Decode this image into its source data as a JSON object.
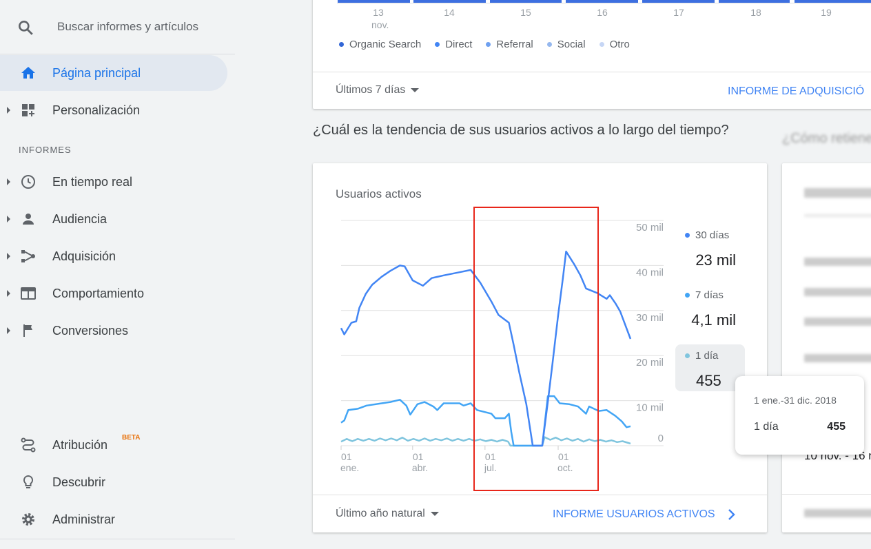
{
  "sidebar": {
    "search_placeholder": "Buscar informes y artículos",
    "items": [
      {
        "label": "Página principal",
        "icon": "home-icon",
        "active": true
      },
      {
        "label": "Personalización",
        "icon": "dashboard-plus-icon"
      }
    ],
    "section_header": "INFORMES",
    "reports": [
      {
        "label": "En tiempo real",
        "icon": "clock-icon"
      },
      {
        "label": "Audiencia",
        "icon": "person-icon"
      },
      {
        "label": "Adquisición",
        "icon": "acquisition-icon"
      },
      {
        "label": "Comportamiento",
        "icon": "behavior-icon"
      },
      {
        "label": "Conversiones",
        "icon": "flag-icon"
      }
    ],
    "bottom": [
      {
        "label": "Atribución",
        "badge": "BETA",
        "icon": "attribution-icon"
      },
      {
        "label": "Descubrir",
        "icon": "lightbulb-icon"
      },
      {
        "label": "Administrar",
        "icon": "gear-icon"
      }
    ]
  },
  "acquisition_card": {
    "x_ticks": [
      "13",
      "14",
      "15",
      "16",
      "17",
      "18",
      "19"
    ],
    "x_month": "nov.",
    "legend": [
      {
        "label": "Organic Search",
        "color": "#3367d6"
      },
      {
        "label": "Direct",
        "color": "#4285f4"
      },
      {
        "label": "Referral",
        "color": "#6fa0f0"
      },
      {
        "label": "Social",
        "color": "#96b8ee"
      },
      {
        "label": "Otro",
        "color": "#c6d6f5"
      }
    ],
    "range_label": "Últimos 7 días",
    "report_link": "INFORME DE ADQUISICIÓ"
  },
  "active_users_section": {
    "heading": "¿Cuál es la tendencia de sus usuarios activos a lo largo del tiempo?",
    "card_title": "Usuarios activos",
    "summary": [
      {
        "label": "30 días",
        "value": "23 mil",
        "color": "#4285f4"
      },
      {
        "label": "7 días",
        "value": "4,1 mil",
        "color": "#42a5f5"
      },
      {
        "label": "1 día",
        "value": "455",
        "color": "#80c5de",
        "highlighted": true
      }
    ],
    "range_label": "Último año natural",
    "report_link": "INFORME USUARIOS ACTIVOS",
    "tooltip": {
      "date": "1 ene.-31 dic. 2018",
      "label": "1 día",
      "value": "455"
    }
  },
  "chart_data": {
    "type": "line",
    "ylim": [
      0,
      50000
    ],
    "y_ticks": [
      {
        "v": 0,
        "label": "0"
      },
      {
        "v": 10000,
        "label": "10 mil"
      },
      {
        "v": 20000,
        "label": "20 mil"
      },
      {
        "v": 30000,
        "label": "30 mil"
      },
      {
        "v": 40000,
        "label": "40 mil"
      },
      {
        "v": 50000,
        "label": "50 mil"
      }
    ],
    "x_ticks": [
      {
        "date": "2018-01-01",
        "day": "01",
        "month": "ene."
      },
      {
        "date": "2018-04-01",
        "day": "01",
        "month": "abr."
      },
      {
        "date": "2018-07-01",
        "day": "01",
        "month": "jul."
      },
      {
        "date": "2018-10-01",
        "day": "01",
        "month": "oct."
      }
    ],
    "xlim": [
      "2018-01-01",
      "2018-12-31"
    ],
    "grid": true,
    "series": [
      {
        "name": "30 días",
        "color": "#4285f4",
        "points": [
          [
            "2018-01-01",
            26100
          ],
          [
            "2018-01-05",
            24700
          ],
          [
            "2018-01-14",
            27300
          ],
          [
            "2018-01-20",
            27600
          ],
          [
            "2018-01-24",
            30600
          ],
          [
            "2018-02-01",
            33700
          ],
          [
            "2018-02-09",
            35700
          ],
          [
            "2018-02-21",
            37500
          ],
          [
            "2018-03-04",
            38800
          ],
          [
            "2018-03-16",
            40000
          ],
          [
            "2018-03-22",
            39800
          ],
          [
            "2018-04-01",
            36700
          ],
          [
            "2018-04-14",
            35500
          ],
          [
            "2018-04-25",
            37200
          ],
          [
            "2018-05-10",
            37800
          ],
          [
            "2018-05-30",
            38500
          ],
          [
            "2018-06-13",
            39000
          ],
          [
            "2018-06-25",
            36200
          ],
          [
            "2018-07-09",
            32000
          ],
          [
            "2018-07-18",
            29000
          ],
          [
            "2018-07-31",
            27300
          ],
          [
            "2018-08-06",
            22400
          ],
          [
            "2018-08-13",
            16300
          ],
          [
            "2018-08-22",
            9200
          ],
          [
            "2018-08-30",
            0
          ],
          [
            "2018-09-11",
            0
          ],
          [
            "2018-09-18",
            9700
          ],
          [
            "2018-09-24",
            18400
          ],
          [
            "2018-10-01",
            29000
          ],
          [
            "2018-10-07",
            37200
          ],
          [
            "2018-10-11",
            43100
          ],
          [
            "2018-10-21",
            40300
          ],
          [
            "2018-10-29",
            37800
          ],
          [
            "2018-11-05",
            34900
          ],
          [
            "2018-11-19",
            33900
          ],
          [
            "2018-12-01",
            32600
          ],
          [
            "2018-12-05",
            33400
          ],
          [
            "2018-12-12",
            31600
          ],
          [
            "2018-12-18",
            29800
          ],
          [
            "2018-12-24",
            27000
          ],
          [
            "2018-12-31",
            23700
          ]
        ]
      },
      {
        "name": "7 días",
        "color": "#42a5f5",
        "points": [
          [
            "2018-01-01",
            5100
          ],
          [
            "2018-01-05",
            5600
          ],
          [
            "2018-01-10",
            7900
          ],
          [
            "2018-01-22",
            8200
          ],
          [
            "2018-02-02",
            8900
          ],
          [
            "2018-02-21",
            9400
          ],
          [
            "2018-03-04",
            9700
          ],
          [
            "2018-03-16",
            10200
          ],
          [
            "2018-03-24",
            8900
          ],
          [
            "2018-03-29",
            6900
          ],
          [
            "2018-04-07",
            9200
          ],
          [
            "2018-04-16",
            9700
          ],
          [
            "2018-04-27",
            8700
          ],
          [
            "2018-05-02",
            7900
          ],
          [
            "2018-05-10",
            9400
          ],
          [
            "2018-05-30",
            9400
          ],
          [
            "2018-06-04",
            8900
          ],
          [
            "2018-06-13",
            9400
          ],
          [
            "2018-06-21",
            7900
          ],
          [
            "2018-07-09",
            7100
          ],
          [
            "2018-07-14",
            6100
          ],
          [
            "2018-07-26",
            6100
          ],
          [
            "2018-07-31",
            7100
          ],
          [
            "2018-08-03",
            3100
          ],
          [
            "2018-08-06",
            0
          ],
          [
            "2018-09-11",
            0
          ],
          [
            "2018-09-18",
            11000
          ],
          [
            "2018-09-26",
            11000
          ],
          [
            "2018-10-03",
            9400
          ],
          [
            "2018-10-15",
            9200
          ],
          [
            "2018-10-26",
            8700
          ],
          [
            "2018-11-05",
            7100
          ],
          [
            "2018-11-09",
            8700
          ],
          [
            "2018-11-21",
            7700
          ],
          [
            "2018-12-01",
            7900
          ],
          [
            "2018-12-12",
            6600
          ],
          [
            "2018-12-20",
            5400
          ],
          [
            "2018-12-26",
            4100
          ],
          [
            "2018-12-31",
            4300
          ]
        ]
      },
      {
        "name": "1 día",
        "color": "#80c5de",
        "points": [
          [
            "2018-01-01",
            900
          ],
          [
            "2018-01-08",
            1500
          ],
          [
            "2018-01-15",
            1000
          ],
          [
            "2018-01-22",
            1500
          ],
          [
            "2018-01-29",
            1100
          ],
          [
            "2018-02-05",
            1500
          ],
          [
            "2018-02-12",
            1100
          ],
          [
            "2018-02-19",
            1600
          ],
          [
            "2018-02-26",
            1200
          ],
          [
            "2018-03-05",
            1600
          ],
          [
            "2018-03-12",
            1200
          ],
          [
            "2018-03-19",
            1800
          ],
          [
            "2018-03-26",
            1100
          ],
          [
            "2018-04-02",
            1500
          ],
          [
            "2018-04-09",
            1100
          ],
          [
            "2018-04-16",
            1600
          ],
          [
            "2018-04-23",
            1100
          ],
          [
            "2018-04-30",
            1500
          ],
          [
            "2018-05-07",
            1200
          ],
          [
            "2018-05-14",
            1600
          ],
          [
            "2018-05-21",
            1100
          ],
          [
            "2018-05-28",
            1500
          ],
          [
            "2018-06-04",
            1100
          ],
          [
            "2018-06-11",
            1500
          ],
          [
            "2018-06-18",
            1100
          ],
          [
            "2018-06-25",
            1400
          ],
          [
            "2018-07-02",
            1000
          ],
          [
            "2018-07-09",
            1300
          ],
          [
            "2018-07-16",
            900
          ],
          [
            "2018-07-23",
            1300
          ],
          [
            "2018-07-30",
            900
          ],
          [
            "2018-08-02",
            0
          ],
          [
            "2018-09-11",
            0
          ],
          [
            "2018-09-14",
            1900
          ],
          [
            "2018-09-21",
            1300
          ],
          [
            "2018-09-28",
            1800
          ],
          [
            "2018-10-05",
            1200
          ],
          [
            "2018-10-12",
            1600
          ],
          [
            "2018-10-19",
            1100
          ],
          [
            "2018-10-26",
            1500
          ],
          [
            "2018-11-02",
            900
          ],
          [
            "2018-11-09",
            1400
          ],
          [
            "2018-11-16",
            1000
          ],
          [
            "2018-11-23",
            1300
          ],
          [
            "2018-11-30",
            900
          ],
          [
            "2018-12-07",
            1200
          ],
          [
            "2018-12-14",
            800
          ],
          [
            "2018-12-21",
            1000
          ],
          [
            "2018-12-31",
            455
          ]
        ]
      }
    ]
  },
  "retention_section": {
    "heading": "¿Cómo retiene",
    "partial_row": "10 nov. - 16 n"
  }
}
